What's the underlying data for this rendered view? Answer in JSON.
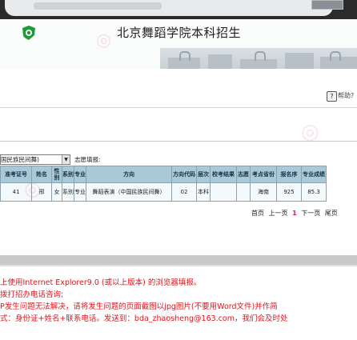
{
  "header": {
    "title": "北京舞蹈学院本科招生"
  },
  "help": {
    "label": "帮助?"
  },
  "form": {
    "major_select_value": "国民族民间舞)",
    "wish_label": "志愿填报:"
  },
  "table": {
    "headers": [
      "准考证号",
      "姓名",
      "性别",
      "系别",
      "专业",
      "方向",
      "方向代码",
      "层次",
      "校考结果",
      "志愿",
      "考点省份",
      "报名序",
      "专业成绩"
    ],
    "rows": [
      [
        "41",
        "邢",
        "女",
        "系别",
        "专业",
        "舞蹈表演（中国民族民间舞）",
        "02",
        "本科",
        "",
        "",
        "海南",
        "925",
        "85.3"
      ]
    ]
  },
  "pager": {
    "first": "首页",
    "prev": "上一页",
    "current": "1",
    "next": "下一页",
    "last": "尾页"
  },
  "notes": {
    "line1": "上使用Internet Explorer9.0 (或以上版本) 的浏览器填报。",
    "line2": "拨打招办电话咨询;",
    "line3": "P发生问题无法解决，请将发生问题的页面截图以jpg图片(不要用Word文件)并作简",
    "line4": "式：身份证+姓名+联系电话。发送到：bda_zhaosheng@163.com，我们会及时处"
  },
  "colors": {
    "accent_red": "#e0151c",
    "table_header": "#a9c9d6",
    "brand_green": "#1f9a3a"
  },
  "icons": {
    "brand": "brand-logo-icon",
    "help": "help-icon"
  }
}
